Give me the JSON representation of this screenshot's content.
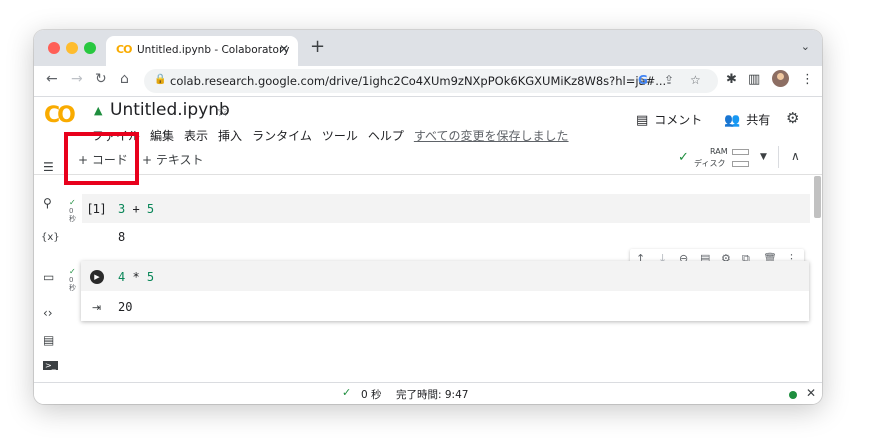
{
  "browser": {
    "tab_favicon": "CO",
    "tab_title": "Untitled.ipynb - Colaboratory",
    "tab_close": "✕",
    "new_tab": "+",
    "tab_menu": "⌄",
    "url": "colab.research.google.com/drive/1ighc2Co4XUm9zNXpPOk6KGXUMiKz8W8s?hl=ja#...",
    "omni_g": "G"
  },
  "colab": {
    "logo": "CO",
    "notebook_title": "Untitled.ipynb",
    "menu": [
      "ファイル",
      "編集",
      "表示",
      "挿入",
      "ランタイム",
      "ツール",
      "ヘルプ"
    ],
    "save_status": "すべての変更を保存しました",
    "comment_label": "コメント",
    "share_label": "共有"
  },
  "toolbar": {
    "add_code_label": "+ コード",
    "add_text_label": "+ テキスト",
    "ram_label": "RAM",
    "disk_label": "ディスク"
  },
  "cells": [
    {
      "status_check": "✓",
      "status_seconds": "0",
      "status_unit": "秒",
      "exec_count": "[1]",
      "code_left": "3",
      "code_op": " + ",
      "code_right": "5",
      "output": "8"
    },
    {
      "status_check": "✓",
      "status_seconds": "0",
      "status_unit": "秒",
      "code_left": "4",
      "code_op": " * ",
      "code_right": "5",
      "output": "20"
    }
  ],
  "statusbar": {
    "check": "✓",
    "time_text": "0 秒",
    "completed_text": "完了時間: 9:47",
    "close": "✕"
  },
  "colors": {
    "accent_orange": "#f9ab00",
    "success_green": "#1e8e3e",
    "highlight_red": "#e8001c"
  },
  "icons": [
    "lock-icon",
    "star-icon",
    "comment-icon",
    "people-icon",
    "gear-icon",
    "run-icon",
    "output-icon",
    "toc-icon",
    "search-icon",
    "variables-icon",
    "folder-icon",
    "code-snippets-icon",
    "command-palette-icon",
    "terminal-icon"
  ]
}
